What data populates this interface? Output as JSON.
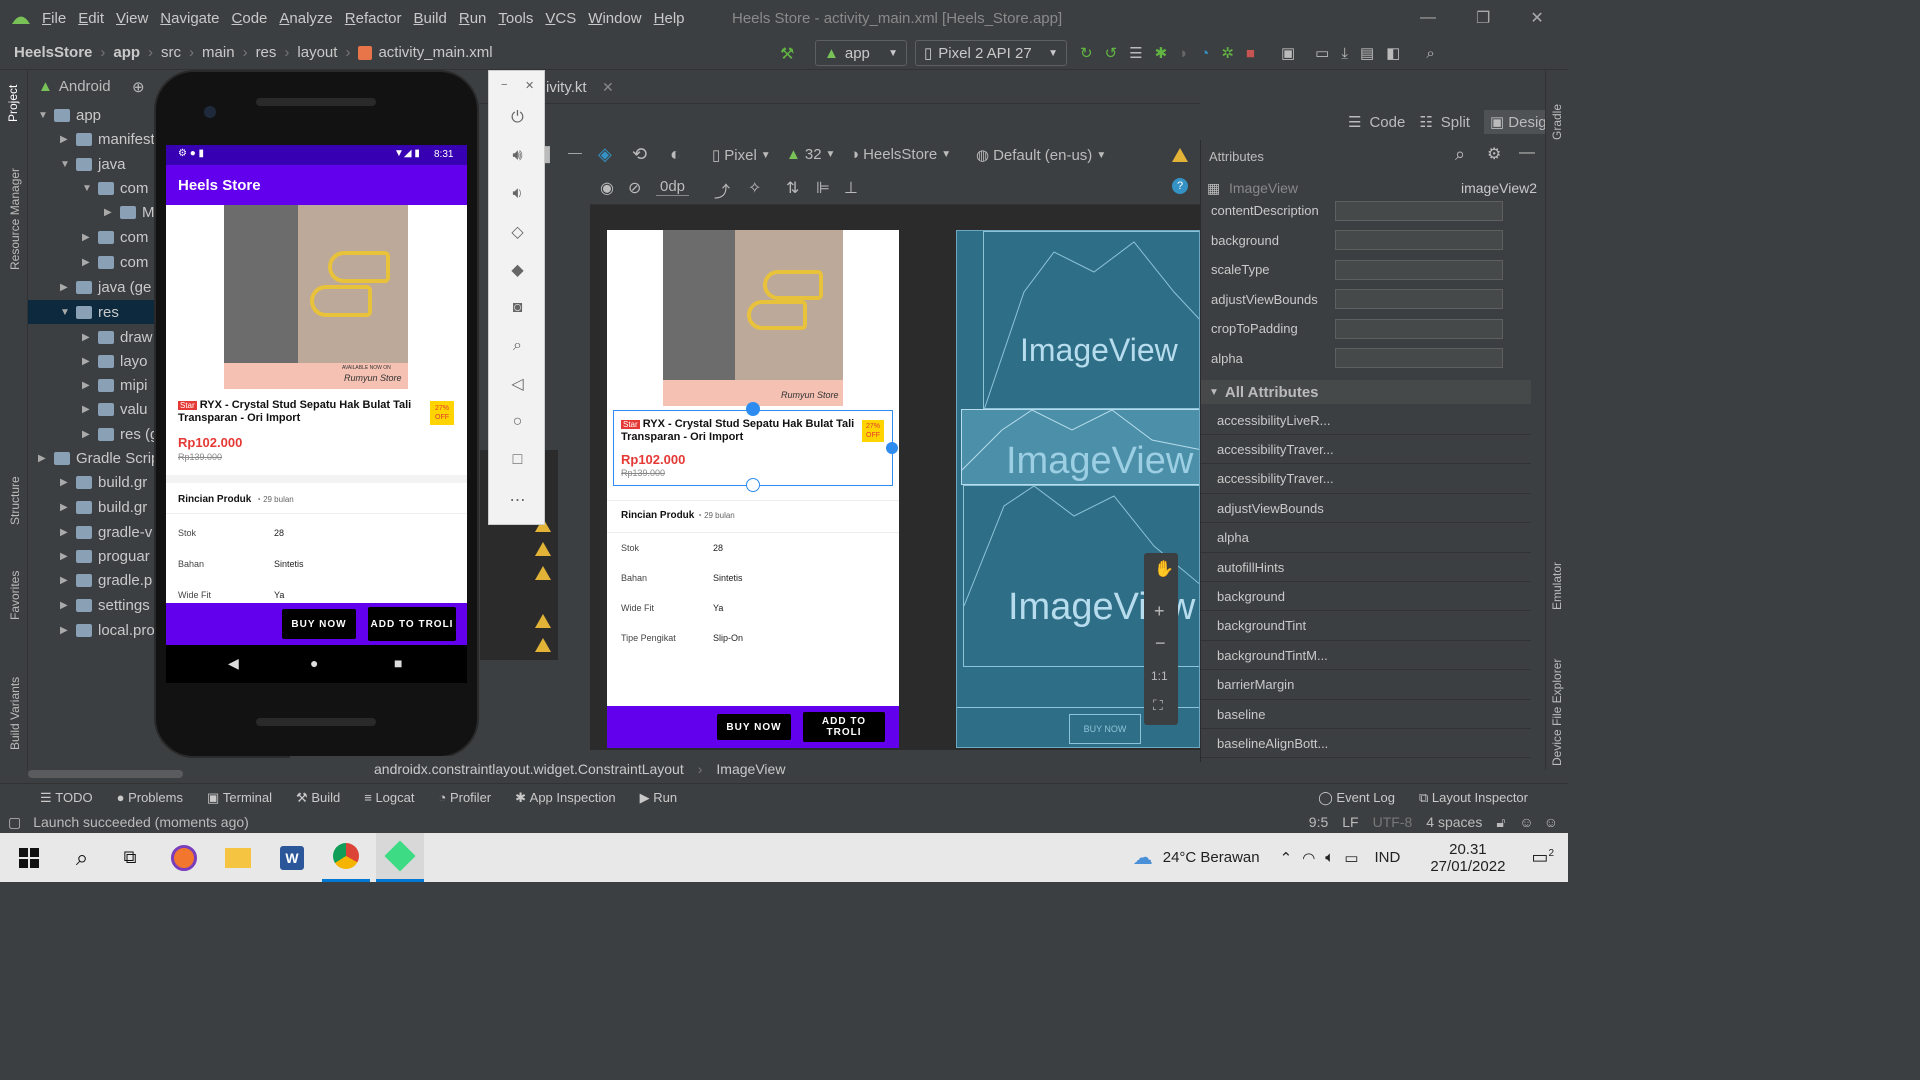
{
  "window": {
    "title": "Heels Store - activity_main.xml [Heels_Store.app]",
    "menu": [
      "File",
      "Edit",
      "View",
      "Navigate",
      "Code",
      "Analyze",
      "Refactor",
      "Build",
      "Run",
      "Tools",
      "VCS",
      "Window",
      "Help"
    ]
  },
  "breadcrumb": [
    "HeelsStore",
    "app",
    "src",
    "main",
    "res",
    "layout",
    "activity_main.xml"
  ],
  "toolbar": {
    "run_config": "app",
    "device": "Pixel 2 API 27"
  },
  "project_panel": {
    "view_mode": "Android",
    "items": [
      {
        "label": "app",
        "level": 0,
        "expanded": true
      },
      {
        "label": "manifests",
        "level": 1
      },
      {
        "label": "java",
        "level": 1,
        "expanded": true
      },
      {
        "label": "com",
        "level": 2,
        "expanded": true
      },
      {
        "label": "M",
        "level": 3
      },
      {
        "label": "com",
        "level": 2
      },
      {
        "label": "com",
        "level": 2
      },
      {
        "label": "java (ge",
        "level": 1
      },
      {
        "label": "res",
        "level": 1,
        "expanded": true
      },
      {
        "label": "draw",
        "level": 2
      },
      {
        "label": "layo",
        "level": 2
      },
      {
        "label": "mipi",
        "level": 2
      },
      {
        "label": "valu",
        "level": 2
      },
      {
        "label": "res (gen",
        "level": 2
      },
      {
        "label": "Gradle Scrip",
        "level": 0
      },
      {
        "label": "build.gr",
        "level": 1
      },
      {
        "label": "build.gr",
        "level": 1
      },
      {
        "label": "gradle-v",
        "level": 1
      },
      {
        "label": "proguar",
        "level": 1
      },
      {
        "label": "gradle.p",
        "level": 1
      },
      {
        "label": "settings",
        "level": 1
      },
      {
        "label": "local.pro",
        "level": 1
      }
    ]
  },
  "left_strip": [
    "Project",
    "Resource Manager",
    "Structure",
    "Favorites",
    "Build Variants"
  ],
  "right_strip": [
    "Gradle",
    "Emulator",
    "Device File Explorer"
  ],
  "editor_tab": "ivity.kt",
  "view_modes": {
    "code": "Code",
    "split": "Split",
    "design": "Design"
  },
  "design_toolbar": {
    "device": "Pixel",
    "api": "32",
    "theme": "HeelsStore",
    "locale": "Default (en-us)",
    "margin": "0dp"
  },
  "phone": {
    "time": "8:31",
    "app_title": "Heels Store",
    "product_name": "RYX - Crystal Stud Sepatu Hak Bulat Tali Transparan - Ori Import",
    "star_badge": "Star",
    "discount": "27% OFF",
    "price": "Rp102.000",
    "old_price": "Rp139.000",
    "details_title": "Rincian Produk",
    "details_time": "29 bulan",
    "specs": [
      {
        "k": "Stok",
        "v": "28"
      },
      {
        "k": "Bahan",
        "v": "Sintetis"
      },
      {
        "k": "Wide Fit",
        "v": "Ya"
      }
    ],
    "buy_now": "BUY NOW",
    "add_to_cart": "ADD TO TROLI",
    "store_text": "Rumyun Store",
    "available_text": "AVAILABLE NOW ON"
  },
  "preview": {
    "product_name": "RYX - Crystal Stud Sepatu Hak Bulat Tali Transparan - Ori Import",
    "star_badge": "Star",
    "discount": "27% OFF",
    "price": "Rp102.000",
    "old_price": "Rp139.000",
    "details_title": "Rincian Produk",
    "details_time": "29 bulan",
    "specs": [
      {
        "k": "Stok",
        "v": "28"
      },
      {
        "k": "Bahan",
        "v": "Sintetis"
      },
      {
        "k": "Wide Fit",
        "v": "Ya"
      },
      {
        "k": "Tipe Pengikat",
        "v": "Slip-On"
      }
    ],
    "buy_now": "BUY NOW",
    "add_to_cart": "ADD TO TROLI",
    "store_text": "Rumyun Store"
  },
  "blueprint": {
    "label": "ImageView",
    "button": "BUY NOW"
  },
  "attributes": {
    "header": "Attributes",
    "component": "ImageView",
    "component_id": "imageView2",
    "common": [
      "contentDescription",
      "background",
      "scaleType",
      "adjustViewBounds",
      "cropToPadding",
      "alpha"
    ],
    "all_header": "All Attributes",
    "all": [
      "accessibilityLiveR...",
      "accessibilityTraver...",
      "accessibilityTraver...",
      "adjustViewBounds",
      "alpha",
      "autofillHints",
      "background",
      "backgroundTint",
      "backgroundTintM...",
      "barrierMargin",
      "baseline",
      "baselineAlignBott..."
    ]
  },
  "component_tree_path": [
    "androidx.constraintlayout.widget.ConstraintLayout",
    "ImageView"
  ],
  "bottom_tabs": [
    "TODO",
    "Problems",
    "Terminal",
    "Build",
    "Logcat",
    "Profiler",
    "App Inspection",
    "Run"
  ],
  "bottom_right_tabs": [
    "Event Log",
    "Layout Inspector"
  ],
  "status": {
    "message": "Launch succeeded (moments ago)",
    "position": "9:5",
    "line_sep": "LF",
    "encoding": "UTF-8",
    "indent": "4 spaces"
  },
  "taskbar": {
    "weather": "24°C  Berawan",
    "lang": "IND",
    "time": "20.31",
    "date": "27/01/2022",
    "notif": "2"
  },
  "colors": {
    "accent_purple": "#6200ee",
    "price_red": "#e53935",
    "ide_bg": "#3c3f41",
    "blueprint": "#2f6e87"
  }
}
